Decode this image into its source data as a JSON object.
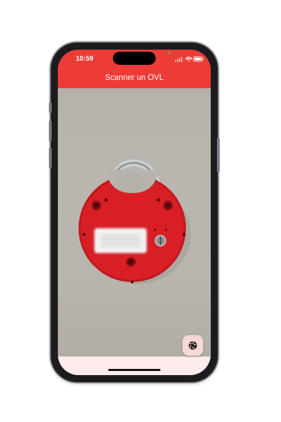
{
  "status_bar": {
    "time": "10:59",
    "signal_icon": "cellular-signal-icon",
    "wifi_icon": "wifi-icon",
    "battery_icon": "battery-icon"
  },
  "header": {
    "title": "Scanner un OVL",
    "background_color": "#ee3b35"
  },
  "camera_view": {
    "subject": "red-padlock",
    "label_blurred": true
  },
  "actions": {
    "capture_icon": "camera-aperture-icon"
  }
}
